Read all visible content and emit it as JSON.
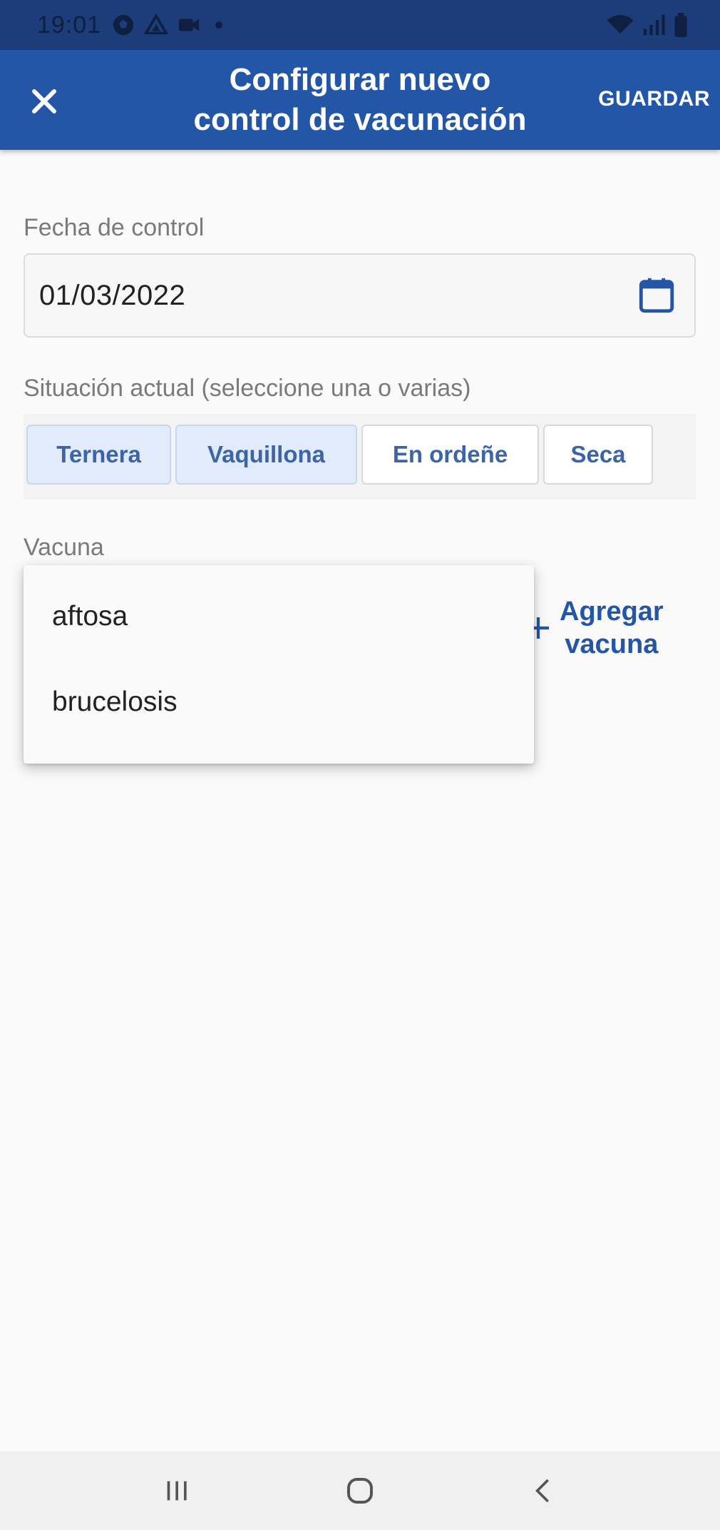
{
  "status_bar": {
    "time": "19:01"
  },
  "app_bar": {
    "title": "Configurar nuevo\ncontrol de vacunación",
    "save_label": "GUARDAR"
  },
  "date_section": {
    "label": "Fecha de control",
    "value": "01/03/2022"
  },
  "situation": {
    "label": "Situación actual (seleccione una o varias)",
    "options": [
      {
        "label": "Ternera",
        "selected": true
      },
      {
        "label": "Vaquillona",
        "selected": true
      },
      {
        "label": "En ordeñe",
        "selected": false
      },
      {
        "label": "Seca",
        "selected": false
      }
    ]
  },
  "vaccine": {
    "label": "Vacuna",
    "add_label": "Agregar\nvacuna",
    "options": [
      "aftosa",
      "brucelosis"
    ]
  },
  "colors": {
    "status_bar": "#1c3d7a",
    "app_bar": "#2356a6",
    "chip_text": "#3c64a8",
    "chip_selected_bg": "#e1ebfa"
  }
}
